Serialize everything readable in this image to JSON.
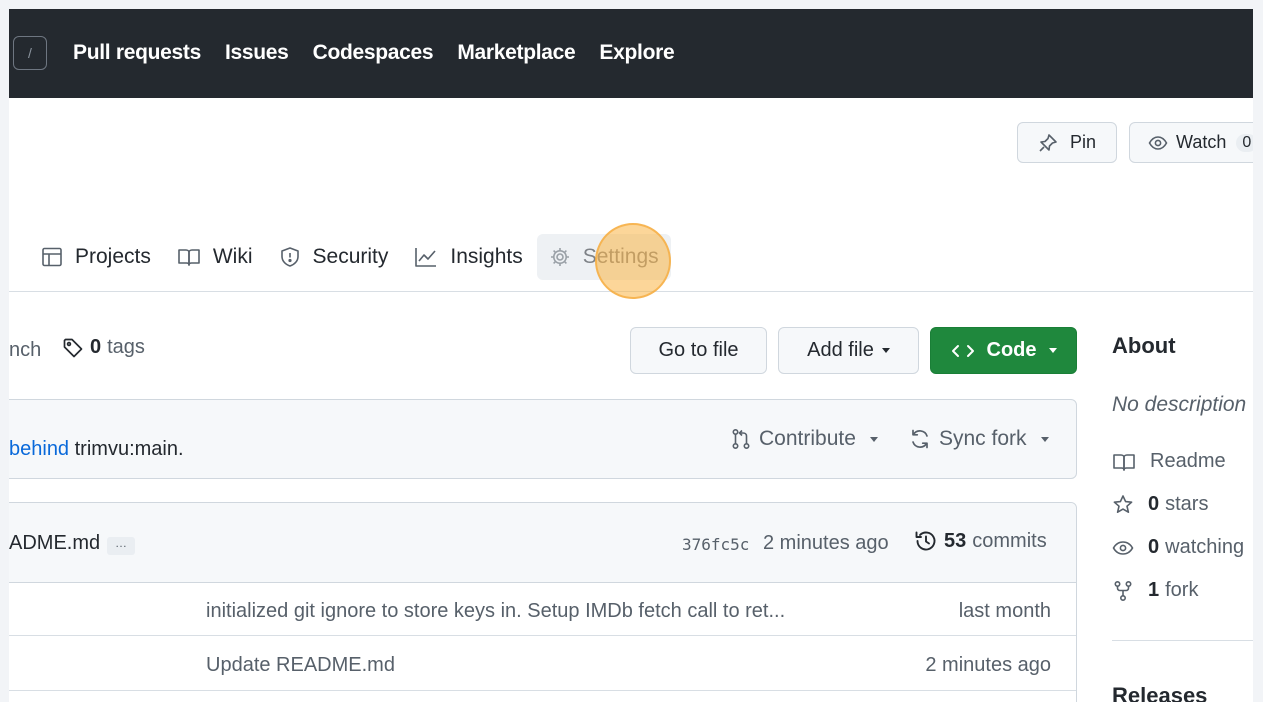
{
  "topnav": {
    "slash_key": "/",
    "links": [
      "Pull requests",
      "Issues",
      "Codespaces",
      "Marketplace",
      "Explore"
    ]
  },
  "header": {
    "pin_label": "Pin",
    "watch_label": "Watch",
    "watch_count": "0"
  },
  "tabs": [
    {
      "label": "Projects",
      "icon": "table-icon"
    },
    {
      "label": "Wiki",
      "icon": "book-icon"
    },
    {
      "label": "Security",
      "icon": "shield-icon"
    },
    {
      "label": "Insights",
      "icon": "graph-icon"
    },
    {
      "label": "Settings",
      "icon": "gear-icon",
      "state": "hovered"
    }
  ],
  "branch_bar": {
    "branch_text": "nch",
    "tags_count": "0",
    "tags_label": "tags",
    "goto_file": "Go to file",
    "add_file": "Add file",
    "code": "Code"
  },
  "sync": {
    "behind_link": "behind",
    "upstream": "trimvu:main.",
    "contribute": "Contribute",
    "sync_fork": "Sync fork"
  },
  "latest_commit": {
    "message": "ADME.md",
    "ellipsis": "…",
    "sha": "376fc5c",
    "time": "2 minutes ago",
    "commits_count": "53",
    "commits_label": "commits"
  },
  "file_rows": [
    {
      "message": "initialized git ignore to store keys in. Setup IMDb fetch call to ret...",
      "age": "last month"
    },
    {
      "message": "Update README.md",
      "age": "2 minutes ago"
    }
  ],
  "sidebar": {
    "about_title": "About",
    "description": "No description",
    "readme": "Readme",
    "stars_count": "0",
    "stars_label": "stars",
    "watching_count": "0",
    "watching_label": "watching",
    "forks_count": "1",
    "forks_label": "fork",
    "releases_title": "Releases"
  },
  "colors": {
    "nav_bg": "#24292f",
    "code_button": "#1f883d",
    "link": "#0969da",
    "click_indicator": "#f5aa3c"
  }
}
